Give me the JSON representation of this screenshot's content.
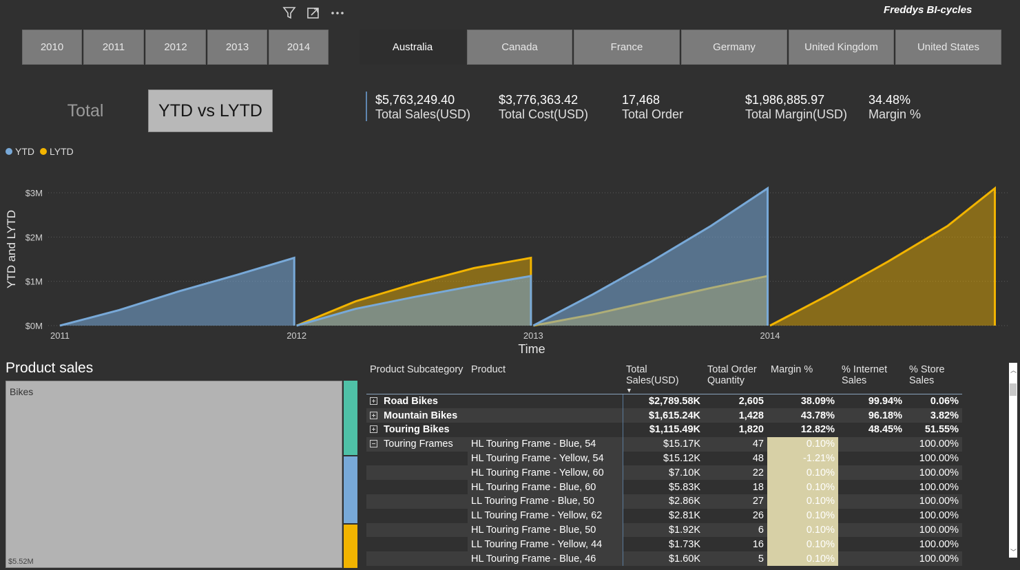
{
  "brand": "Freddys BI-cycles",
  "toolbar": {
    "filter_icon": "filter-icon",
    "focus_icon": "focus-mode-icon",
    "more_icon": "more-options-icon"
  },
  "year_slicer": [
    "2010",
    "2011",
    "2012",
    "2013",
    "2014"
  ],
  "country_slicer": {
    "items": [
      "Australia",
      "Canada",
      "France",
      "Germany",
      "United Kingdom",
      "United States"
    ],
    "selected": "Australia"
  },
  "toggle": {
    "total": "Total",
    "ytd_vs_lytd": "YTD vs LYTD",
    "selected": "YTD vs LYTD"
  },
  "kpis": [
    {
      "value": "$5,763,249.40",
      "label": "Total Sales(USD)"
    },
    {
      "value": "$3,776,363.42",
      "label": "Total Cost(USD)"
    },
    {
      "value": "17,468",
      "label": "Total Order"
    },
    {
      "value": "$1,986,885.97",
      "label": "Total Margin(USD)"
    },
    {
      "value": "34.48%",
      "label": "Margin %"
    }
  ],
  "chart_data": {
    "type": "area",
    "xlabel": "Time",
    "ylabel": "YTD and LYTD",
    "x_ticks": [
      "2011",
      "2012",
      "2013",
      "2014"
    ],
    "y_ticks": [
      "$0M",
      "$1M",
      "$2M",
      "$3M"
    ],
    "ylim": [
      0,
      3300000
    ],
    "grid": true,
    "legend": "top-left",
    "colors": {
      "YTD": "#78a9d8",
      "LYTD": "#f2b400"
    },
    "series": [
      {
        "name": "YTD",
        "points": [
          [
            2011.0,
            0
          ],
          [
            2011.25,
            350000
          ],
          [
            2011.5,
            770000
          ],
          [
            2011.75,
            1150000
          ],
          [
            2011.99,
            1530000
          ],
          [
            2012.0,
            0
          ],
          [
            2012.25,
            380000
          ],
          [
            2012.5,
            650000
          ],
          [
            2012.75,
            900000
          ],
          [
            2012.99,
            1120000
          ],
          [
            2013.0,
            0
          ],
          [
            2013.25,
            700000
          ],
          [
            2013.5,
            1450000
          ],
          [
            2013.75,
            2250000
          ],
          [
            2013.99,
            3100000
          ],
          [
            2014.0,
            0
          ],
          [
            2014.95,
            0
          ]
        ]
      },
      {
        "name": "LYTD",
        "points": [
          [
            2012.0,
            0
          ],
          [
            2012.25,
            550000
          ],
          [
            2012.5,
            950000
          ],
          [
            2012.75,
            1300000
          ],
          [
            2012.99,
            1530000
          ],
          [
            2013.0,
            0
          ],
          [
            2013.25,
            250000
          ],
          [
            2013.5,
            550000
          ],
          [
            2013.75,
            850000
          ],
          [
            2013.99,
            1120000
          ],
          [
            2014.0,
            0
          ],
          [
            2014.25,
            700000
          ],
          [
            2014.5,
            1450000
          ],
          [
            2014.75,
            2250000
          ],
          [
            2014.95,
            3100000
          ]
        ]
      }
    ]
  },
  "product_sales": {
    "title": "Product sales",
    "category": "Bikes",
    "value": "$5.52M",
    "side_colors": [
      "#4fc1a7",
      "#78a9d8",
      "#f2b400"
    ]
  },
  "table": {
    "headers": [
      "Product Subcategory",
      "Product",
      "Total Sales(USD)",
      "Total Order Quantity",
      "Margin %",
      "% Internet Sales",
      "% Store Sales"
    ],
    "rows": [
      {
        "sub": "Road Bikes",
        "product": "",
        "sales": "$2,789.58K",
        "qty": "2,605",
        "margin": "38.09%",
        "internet": "99.94%",
        "store": "0.06%",
        "bold": true,
        "expander": "plus"
      },
      {
        "sub": "Mountain Bikes",
        "product": "",
        "sales": "$1,615.24K",
        "qty": "1,428",
        "margin": "43.78%",
        "internet": "96.18%",
        "store": "3.82%",
        "bold": true,
        "expander": "plus"
      },
      {
        "sub": "Touring Bikes",
        "product": "",
        "sales": "$1,115.49K",
        "qty": "1,820",
        "margin": "12.82%",
        "internet": "48.45%",
        "store": "51.55%",
        "bold": true,
        "expander": "plus"
      },
      {
        "sub": "Touring Frames",
        "product": "HL Touring Frame - Blue, 54",
        "sales": "$15.17K",
        "qty": "47",
        "margin": "0.10%",
        "internet": "",
        "store": "100.00%",
        "bold": false,
        "expander": "minus",
        "hl": true
      },
      {
        "sub": "",
        "product": "HL Touring Frame - Yellow, 54",
        "sales": "$15.12K",
        "qty": "48",
        "margin": "-1.21%",
        "internet": "",
        "store": "100.00%",
        "bold": false,
        "hl": true
      },
      {
        "sub": "",
        "product": "HL Touring Frame - Yellow, 60",
        "sales": "$7.10K",
        "qty": "22",
        "margin": "0.10%",
        "internet": "",
        "store": "100.00%",
        "bold": false,
        "hl": true
      },
      {
        "sub": "",
        "product": "HL Touring Frame - Blue, 60",
        "sales": "$5.83K",
        "qty": "18",
        "margin": "0.10%",
        "internet": "",
        "store": "100.00%",
        "bold": false,
        "hl": true
      },
      {
        "sub": "",
        "product": "LL Touring Frame - Blue, 50",
        "sales": "$2.86K",
        "qty": "27",
        "margin": "0.10%",
        "internet": "",
        "store": "100.00%",
        "bold": false,
        "hl": true
      },
      {
        "sub": "",
        "product": "LL Touring Frame - Yellow, 62",
        "sales": "$2.81K",
        "qty": "26",
        "margin": "0.10%",
        "internet": "",
        "store": "100.00%",
        "bold": false,
        "hl": true
      },
      {
        "sub": "",
        "product": "HL Touring Frame - Blue, 50",
        "sales": "$1.92K",
        "qty": "6",
        "margin": "0.10%",
        "internet": "",
        "store": "100.00%",
        "bold": false,
        "hl": true
      },
      {
        "sub": "",
        "product": "LL Touring Frame - Yellow, 44",
        "sales": "$1.73K",
        "qty": "16",
        "margin": "0.10%",
        "internet": "",
        "store": "100.00%",
        "bold": false,
        "hl": true
      },
      {
        "sub": "",
        "product": "HL Touring Frame - Blue, 46",
        "sales": "$1.60K",
        "qty": "5",
        "margin": "0.10%",
        "internet": "",
        "store": "100.00%",
        "bold": false,
        "hl": true
      }
    ]
  }
}
